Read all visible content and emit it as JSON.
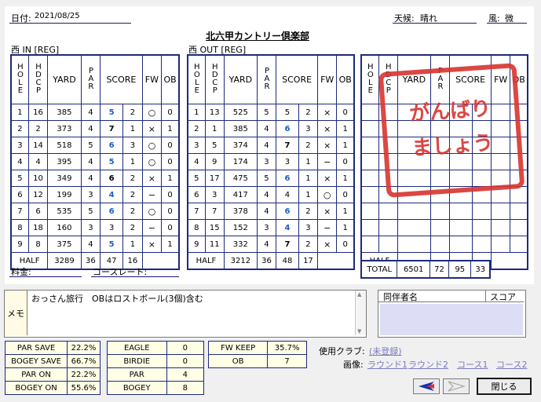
{
  "header": {
    "date_label": "日付:",
    "date_value": "2021/08/25",
    "weather_label": "天候:",
    "weather_value": "晴れ",
    "wind_label": "風:",
    "wind_value": "微",
    "course_name": "北六甲カントリー倶楽部"
  },
  "sections": {
    "in_label": "西 IN [REG]",
    "out_label": "西 OUT [REG]"
  },
  "columns": {
    "hole": "HOLE",
    "hdcp": "HDCP",
    "yard": "YARD",
    "par": "PAR",
    "score": "SCORE",
    "fw": "FW",
    "ob": "OB"
  },
  "in_rows": [
    {
      "hole": "1",
      "hdcp": "16",
      "yard": "385",
      "par": "4",
      "score": "5",
      "putt": "2",
      "fw": "○",
      "ob": "0",
      "color": "blue"
    },
    {
      "hole": "2",
      "hdcp": "2",
      "yard": "373",
      "par": "4",
      "score": "7",
      "putt": "1",
      "fw": "×",
      "ob": "1",
      "color": "black"
    },
    {
      "hole": "3",
      "hdcp": "14",
      "yard": "518",
      "par": "5",
      "score": "6",
      "putt": "3",
      "fw": "○",
      "ob": "0",
      "color": "blue"
    },
    {
      "hole": "4",
      "hdcp": "4",
      "yard": "395",
      "par": "4",
      "score": "5",
      "putt": "1",
      "fw": "○",
      "ob": "0",
      "color": "blue"
    },
    {
      "hole": "5",
      "hdcp": "10",
      "yard": "349",
      "par": "4",
      "score": "6",
      "putt": "2",
      "fw": "×",
      "ob": "1",
      "color": "black"
    },
    {
      "hole": "6",
      "hdcp": "12",
      "yard": "199",
      "par": "3",
      "score": "4",
      "putt": "2",
      "fw": "−",
      "ob": "0",
      "color": "blue"
    },
    {
      "hole": "7",
      "hdcp": "6",
      "yard": "535",
      "par": "5",
      "score": "6",
      "putt": "2",
      "fw": "○",
      "ob": "0",
      "color": "blue"
    },
    {
      "hole": "8",
      "hdcp": "18",
      "yard": "160",
      "par": "3",
      "score": "3",
      "putt": "2",
      "fw": "−",
      "ob": "0",
      "color": "plain"
    },
    {
      "hole": "9",
      "hdcp": "8",
      "yard": "375",
      "par": "4",
      "score": "5",
      "putt": "1",
      "fw": "×",
      "ob": "1",
      "color": "blue"
    }
  ],
  "in_half": {
    "label": "HALF",
    "yard": "3289",
    "par": "36",
    "score": "47",
    "putt": "16"
  },
  "out_rows": [
    {
      "hole": "1",
      "hdcp": "13",
      "yard": "525",
      "par": "5",
      "score": "5",
      "putt": "2",
      "fw": "×",
      "ob": "0",
      "color": "plain"
    },
    {
      "hole": "2",
      "hdcp": "1",
      "yard": "385",
      "par": "4",
      "score": "6",
      "putt": "3",
      "fw": "×",
      "ob": "1",
      "color": "blue"
    },
    {
      "hole": "3",
      "hdcp": "5",
      "yard": "374",
      "par": "4",
      "score": "7",
      "putt": "2",
      "fw": "×",
      "ob": "1",
      "color": "black"
    },
    {
      "hole": "4",
      "hdcp": "9",
      "yard": "174",
      "par": "3",
      "score": "3",
      "putt": "1",
      "fw": "−",
      "ob": "0",
      "color": "plain"
    },
    {
      "hole": "5",
      "hdcp": "17",
      "yard": "475",
      "par": "5",
      "score": "6",
      "putt": "1",
      "fw": "×",
      "ob": "1",
      "color": "blue"
    },
    {
      "hole": "6",
      "hdcp": "3",
      "yard": "417",
      "par": "4",
      "score": "4",
      "putt": "1",
      "fw": "○",
      "ob": "0",
      "color": "plain"
    },
    {
      "hole": "7",
      "hdcp": "7",
      "yard": "378",
      "par": "4",
      "score": "6",
      "putt": "2",
      "fw": "×",
      "ob": "1",
      "color": "blue"
    },
    {
      "hole": "8",
      "hdcp": "15",
      "yard": "152",
      "par": "3",
      "score": "4",
      "putt": "3",
      "fw": "−",
      "ob": "1",
      "color": "blue"
    },
    {
      "hole": "9",
      "hdcp": "11",
      "yard": "332",
      "par": "4",
      "score": "7",
      "putt": "2",
      "fw": "×",
      "ob": "0",
      "color": "black"
    }
  ],
  "out_half": {
    "label": "HALF",
    "yard": "3212",
    "par": "36",
    "score": "48",
    "putt": "17"
  },
  "third_half_label": "HALF",
  "total": {
    "label": "TOTAL",
    "yard": "6501",
    "par": "72",
    "score": "95",
    "putt": "33"
  },
  "stamp": {
    "line1": "がんばり",
    "line2": "ましょう"
  },
  "fee_label": "料金:",
  "course_rate_label": "コースレート:",
  "memo": {
    "label": "メモ",
    "text": "おっさん旅行　OBはロストボール(3個)含む"
  },
  "companions": {
    "name_header": "同伴者名",
    "score_header": "スコア"
  },
  "stats1": [
    {
      "label": "PAR SAVE",
      "value": "22.2%"
    },
    {
      "label": "BOGEY SAVE",
      "value": "66.7%"
    },
    {
      "label": "PAR ON",
      "value": "22.2%"
    },
    {
      "label": "BOGEY ON",
      "value": "55.6%"
    }
  ],
  "stats2": [
    {
      "label": "EAGLE",
      "value": "0"
    },
    {
      "label": "BIRDIE",
      "value": "0"
    },
    {
      "label": "PAR",
      "value": "4"
    },
    {
      "label": "BOGEY",
      "value": "8"
    }
  ],
  "stats3": [
    {
      "label": "FW KEEP",
      "value": "35.7%"
    },
    {
      "label": "OB",
      "value": "7"
    }
  ],
  "clubs": {
    "label": "使用クラブ:",
    "value": "(未登録)"
  },
  "images": {
    "label": "画像:",
    "items": [
      "ラウンド1",
      "ラウンド2",
      "コース1",
      "コース2"
    ]
  },
  "buttons": {
    "close": "閉じる"
  },
  "colors": {
    "table_border": "#1d2a7a",
    "score_blue": "#1a5fc8",
    "stamp_red": "#d8342f"
  }
}
